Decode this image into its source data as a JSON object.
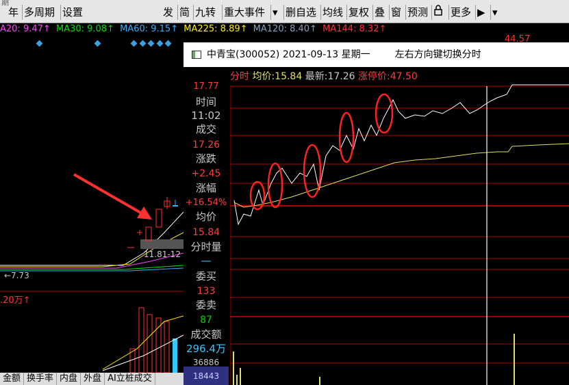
{
  "toolbar": {
    "items": [
      "年",
      "多周期",
      "设置",
      "发",
      "简",
      "九转",
      "重大事件",
      "▾",
      "删自选",
      "均线",
      "复权",
      "叠",
      "窗",
      "预测",
      "更多",
      "▶"
    ],
    "first": "期"
  },
  "ma": {
    "items": [
      {
        "label": "A20: 9.47↑",
        "color": "#ff44ff"
      },
      {
        "label": "MA30: 9.08↑",
        "color": "#00e000"
      },
      {
        "label": "MA60: 9.15↑",
        "color": "#3ab0ff"
      },
      {
        "label": "MA225: 8.89↑",
        "color": "#ffee00"
      },
      {
        "label": "MA120: 8.40↑",
        "color": "#88a0c0"
      },
      {
        "label": "MA144: 8.32↑",
        "color": "#ff3333"
      }
    ],
    "right_price": "44.57"
  },
  "kchart": {
    "price_low": "←7.73",
    "range_label": "11.81-12",
    "volume_label": ".20万↑"
  },
  "popup": {
    "title": "中青宝(300052) 2021-09-13 星期一",
    "hint": "左右方向键切换分时"
  },
  "info": {
    "mode": "分时",
    "avg_label": "均价:",
    "avg": "15.84",
    "latest_label": "最新:",
    "latest": "17.26",
    "limit_label": "涨停价:",
    "limit": "47.50"
  },
  "side": {
    "time_label": "时间",
    "time": "11:02",
    "deal_label": "成交",
    "deal": "17.26",
    "change_label": "涨跌",
    "change": "+2.45",
    "pct_label": "涨幅",
    "pct": "+16.54%",
    "avgp_label": "均价",
    "avgp": "15.84",
    "vol_label": "分时量",
    "vol": "—",
    "buy_label": "委买",
    "buy": "133",
    "sell_label": "委卖",
    "sell": "87",
    "amount_label": "成交额",
    "amount": "296.4万"
  },
  "axis": {
    "top_price": "17.77",
    "vol1": "36886",
    "vol2": "18443"
  },
  "bottom_tabs": [
    "金额",
    "换手率",
    "内盘",
    "外盘",
    "AI立桩成交"
  ],
  "colors": {
    "price_line": "#ffffff",
    "avg_line": "#e0e060",
    "grid": "#b00000",
    "ring": "#ff2020",
    "arrow": "#ff3030"
  }
}
